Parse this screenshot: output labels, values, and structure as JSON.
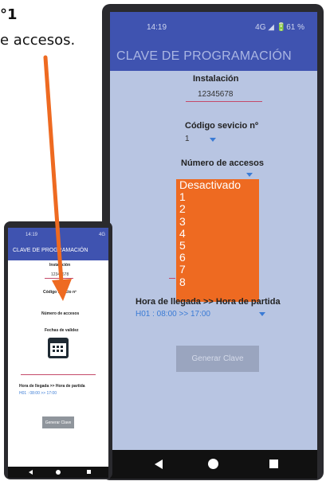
{
  "caption": {
    "step": "°1",
    "description": "e accesos."
  },
  "big_phone": {
    "status_time": "14:19",
    "status_right": "4G ◢ 🔋61 %",
    "app_title": "CLAVE DE PROGRAMACIÓN",
    "instalacion_label": "Instalación",
    "instalacion_value": "12345678",
    "codigo_label": "Código sevicio nº",
    "codigo_value": "1",
    "accesos_label": "Número de accesos",
    "accesos_options": [
      "Desactivado",
      "1",
      "2",
      "3",
      "4",
      "5",
      "6",
      "7",
      "8"
    ],
    "hora_label": "Hora de llegada >> Hora de partida",
    "hora_value": "H01 : 08:00 >> 17:00",
    "generate_button": "Generar Clave"
  },
  "small_phone": {
    "status_time": "14:19",
    "status_right": "4G",
    "app_title": "CLAVE DE PROGRAMACIÓN",
    "instalacion_label": "Instalación",
    "instalacion_value": "12345678",
    "codigo_label": "Código sevicio nº",
    "accesos_label": "Número de accesos",
    "fechas_label": "Fechas de validez",
    "hora_label": "Hora de llegada >> Hora de partida",
    "hora_value": "H01 : 08:00 >> 17:00",
    "generate_button": "Generar Clave"
  },
  "colors": {
    "appbar": "#3f53b0",
    "dropdown_highlight": "#ee6a21",
    "arrow": "#ee6a21",
    "link_blue": "#3a7bd5"
  },
  "icons": [
    "back-icon",
    "home-icon",
    "recents-icon",
    "calendar-icon",
    "dropdown-arrow-icon"
  ]
}
